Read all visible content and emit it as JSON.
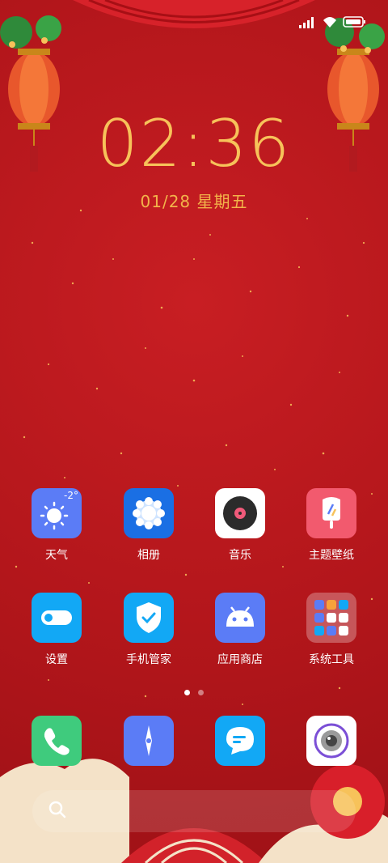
{
  "status_bar": {
    "signal_icon": "signal-icon",
    "wifi_icon": "wifi-icon",
    "battery_icon": "battery-icon"
  },
  "lockclock": {
    "time": "02:36",
    "date": "01/28 星期五"
  },
  "home_apps": [
    {
      "label": "天气",
      "icon": "weather-icon",
      "badge": "-2°",
      "color": "#5b7cf6"
    },
    {
      "label": "相册",
      "icon": "gallery-icon",
      "color": "#1a6fe4"
    },
    {
      "label": "音乐",
      "icon": "music-icon",
      "color": "#ffffff"
    },
    {
      "label": "主题壁纸",
      "icon": "theme-icon",
      "color": "#f25a6e"
    },
    {
      "label": "设置",
      "icon": "settings-icon",
      "color": "#12a8f5"
    },
    {
      "label": "手机管家",
      "icon": "security-icon",
      "color": "#12a8f5"
    },
    {
      "label": "应用商店",
      "icon": "appstore-icon",
      "color": "#5b7cf6"
    },
    {
      "label": "系统工具",
      "icon": "folder-icon",
      "color": "#ca5a5e"
    }
  ],
  "page_indicator": {
    "count": 2,
    "active": 0
  },
  "dock": [
    {
      "icon": "phone-icon",
      "color": "#3fcb7d"
    },
    {
      "icon": "browser-icon",
      "color": "#5b7cf6"
    },
    {
      "icon": "messages-icon",
      "color": "#12a8f5"
    },
    {
      "icon": "camera-icon",
      "color": "#ffffff"
    }
  ],
  "search": {
    "icon": "search-icon"
  },
  "colors": {
    "background": "#b8141b",
    "clock": "#f7c25a"
  }
}
